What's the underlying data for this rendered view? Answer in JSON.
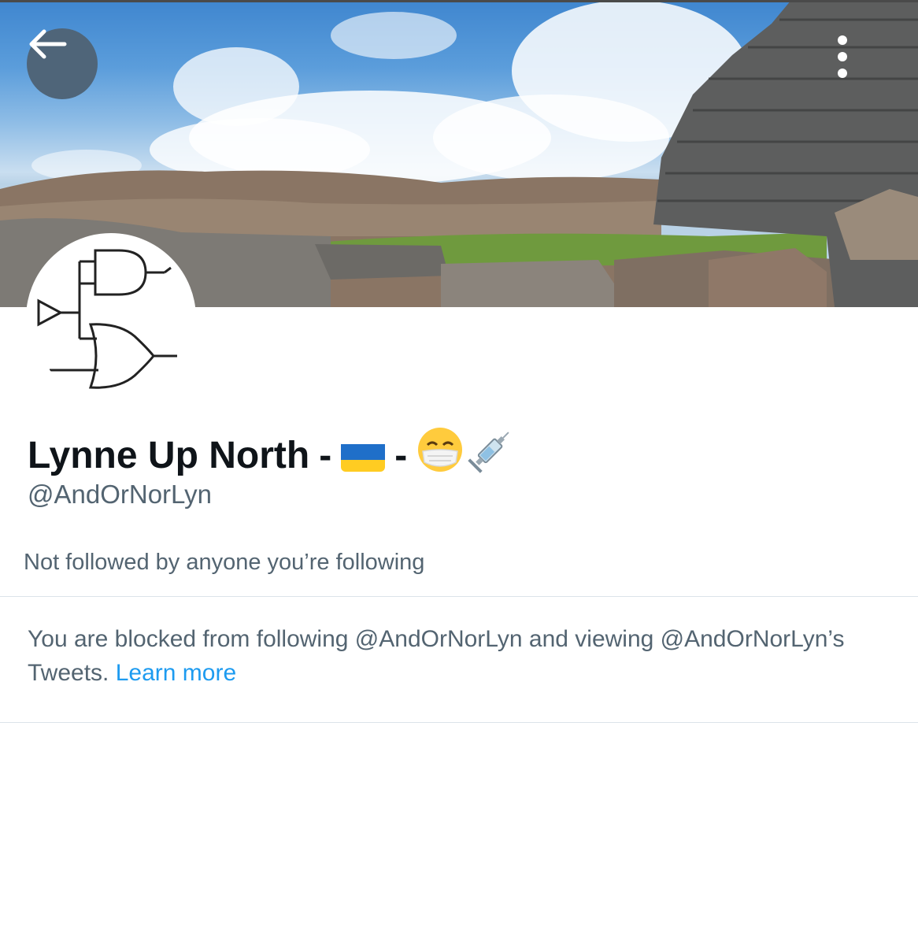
{
  "header": {
    "back_icon": "arrow-left-icon",
    "more_icon": "vertical-ellipsis-icon"
  },
  "profile": {
    "name_text": "Lynne Up North",
    "name_separator_1": "-",
    "name_separator_2": "-",
    "name_emojis": [
      "ukraine-flag",
      "face-with-medical-mask",
      "syringe"
    ],
    "handle": "@AndOrNorLyn",
    "followers_note": "Not followed by anyone you’re following"
  },
  "blocked_notice": {
    "text": "You are blocked from following @AndOrNorLyn and viewing @AndOrNorLyn’s Tweets.",
    "link_label": "Learn more"
  },
  "colors": {
    "accent": "#1d9bf0",
    "secondary_text": "#536471",
    "primary_text": "#0f1419",
    "button_bg": "#4f6579"
  }
}
